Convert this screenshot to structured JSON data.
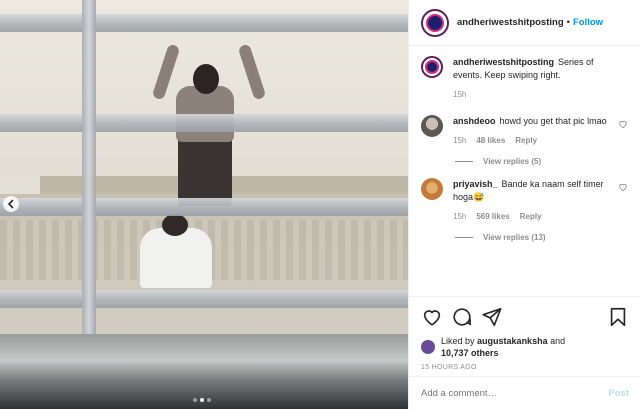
{
  "post": {
    "account": "andheriwestshitposting",
    "separator": "•",
    "follow_label": "Follow",
    "caption": {
      "username": "andheriwestshitposting",
      "text": "Series of events. Keep swiping right.",
      "time": "15h"
    },
    "photo": {
      "carousel_index": 1,
      "carousel_total": 3,
      "prev_icon": "chevron-left-icon"
    }
  },
  "comments": [
    {
      "username": "anshdeoo",
      "text": "howd you get that pic lmao",
      "time": "15h",
      "likes": "48 likes",
      "reply_label": "Reply",
      "view_replies": "View replies (5)"
    },
    {
      "username": "priyavish_",
      "text": "Bande ka naam self timer hoga😅",
      "time": "15h",
      "likes": "569 likes",
      "reply_label": "Reply",
      "view_replies": "View replies (13)"
    }
  ],
  "actions": {
    "like_icon": "heart-icon",
    "comment_icon": "comment-icon",
    "share_icon": "share-icon",
    "save_icon": "bookmark-icon",
    "liked_by_prefix": "Liked by",
    "liked_by_user": "augustakanksha",
    "liked_by_and": "and",
    "others": "10,737 others",
    "timestamp": "15 HOURS AGO"
  },
  "add_comment": {
    "placeholder": "Add a comment…",
    "post_label": "Post"
  },
  "colors": {
    "link": "#0095f6",
    "post_disabled": "#b2dffc",
    "muted": "#8e8e8e"
  }
}
